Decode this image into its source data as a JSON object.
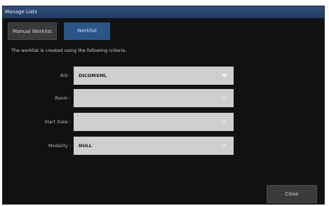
{
  "window": {
    "title": "Manage Lists"
  },
  "tabs": {
    "manual_label": "Manual Worklist",
    "worklist_label": "Worklist"
  },
  "description": "The worklist is created using the following criteria.",
  "form": {
    "ris": {
      "label": "RIS :",
      "value": "DICOMXML"
    },
    "room": {
      "label": "Room :",
      "value": ""
    },
    "start_date": {
      "label": "Start Date :",
      "value": ""
    },
    "modality": {
      "label": "Modality :",
      "value": "NULL"
    }
  },
  "buttons": {
    "close_label": "Close"
  },
  "colors": {
    "titlebar": "#1f3c63",
    "active_tab": "#2a5588",
    "window_bg": "#111111",
    "combo_bg": "#cfcfcf"
  },
  "icons": {
    "dropdown": "chevron-down-icon"
  }
}
